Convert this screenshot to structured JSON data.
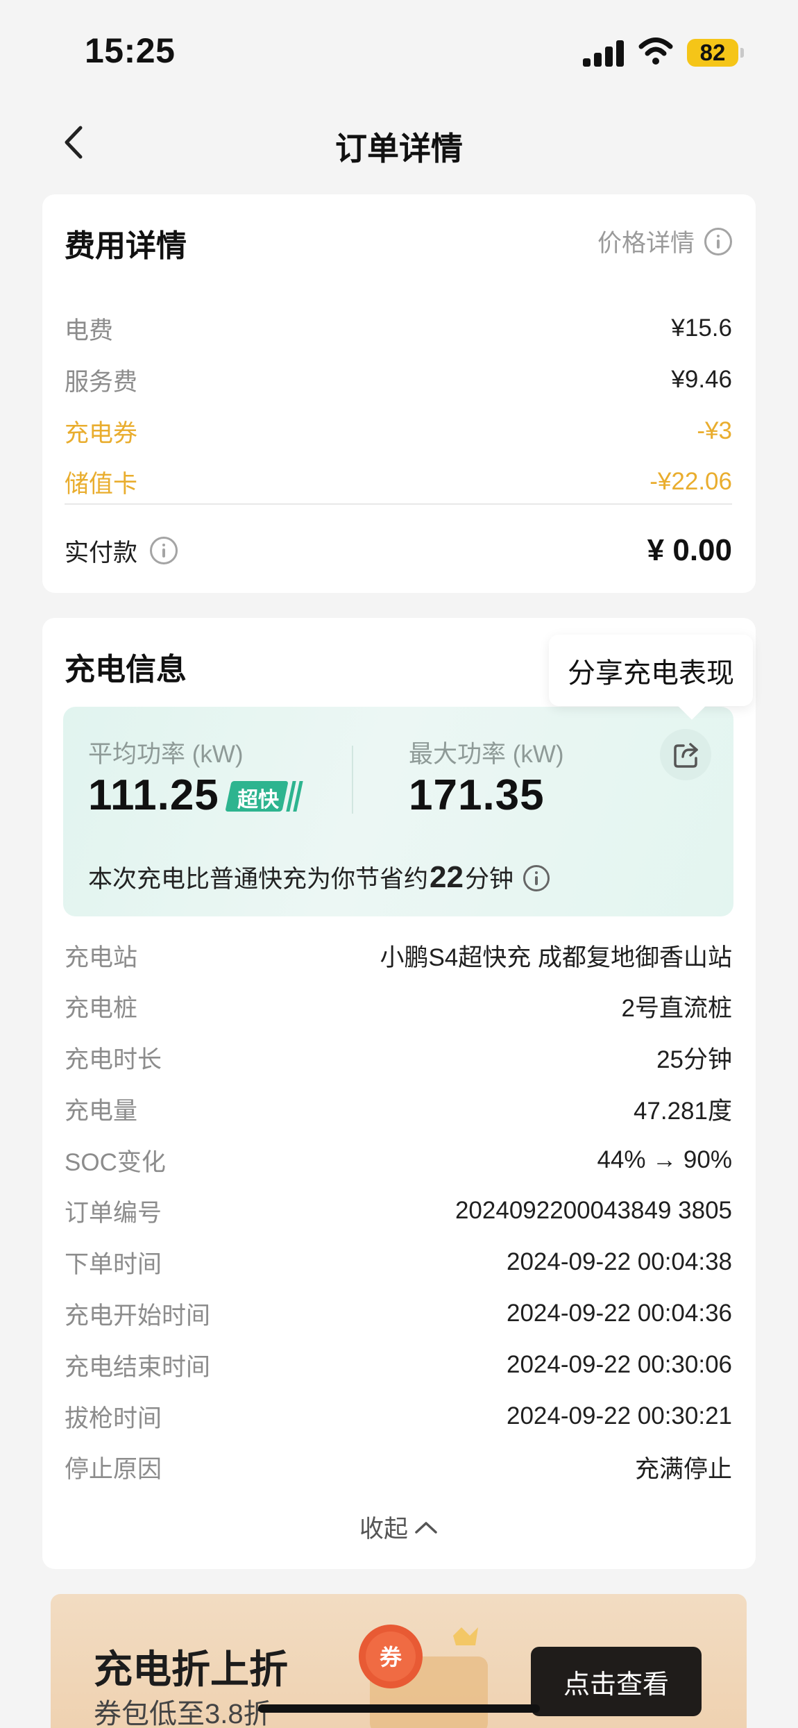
{
  "status_bar": {
    "time": "15:25",
    "battery": "82"
  },
  "nav": {
    "title": "订单详情"
  },
  "fee_card": {
    "title": "费用详情",
    "price_detail_label": "价格详情",
    "rows": [
      {
        "label": "电费",
        "value": "¥15.6"
      },
      {
        "label": "服务费",
        "value": "¥9.46"
      },
      {
        "label": "充电券",
        "value": "-¥3"
      },
      {
        "label": "储值卡",
        "value": "-¥22.06"
      }
    ],
    "paid_label": "实付款",
    "paid_value": "¥ 0.00"
  },
  "charge_card": {
    "title": "充电信息",
    "share_tooltip": "分享充电表现",
    "avg_power_label": "平均功率 (kW)",
    "avg_power_value": "111.25",
    "fast_badge": "超快",
    "max_power_label": "最大功率 (kW)",
    "max_power_value": "171.35",
    "save_prefix": "本次充电比普通快充为你节省约",
    "save_minutes": "22",
    "save_suffix": "分钟",
    "rows": [
      {
        "label": "充电站",
        "value": "小鹏S4超快充 成都复地御香山站"
      },
      {
        "label": "充电桩",
        "value": "2号直流桩"
      },
      {
        "label": "充电时长",
        "value": "25分钟"
      },
      {
        "label": "充电量",
        "value": "47.281度"
      },
      {
        "label": "SOC变化",
        "value": "44% → 90%"
      },
      {
        "label": "订单编号",
        "value": "2024092200043849 3805"
      },
      {
        "label": "下单时间",
        "value": "2024-09-22 00:04:38"
      },
      {
        "label": "充电开始时间",
        "value": "2024-09-22 00:04:36"
      },
      {
        "label": "充电结束时间",
        "value": "2024-09-22 00:30:06"
      },
      {
        "label": "拔枪时间",
        "value": "2024-09-22 00:30:21"
      },
      {
        "label": "停止原因",
        "value": "充满停止"
      }
    ],
    "collapse_label": "收起"
  },
  "banner": {
    "title": "充电折上折",
    "subtitle": "券包低至3.8折",
    "button": "点击查看",
    "coupon_char": "券"
  },
  "colors": {
    "accent_yellow": "#e9ad2e",
    "badge_green": "#2db48f",
    "power_box_bg": "#e6f5f1"
  }
}
